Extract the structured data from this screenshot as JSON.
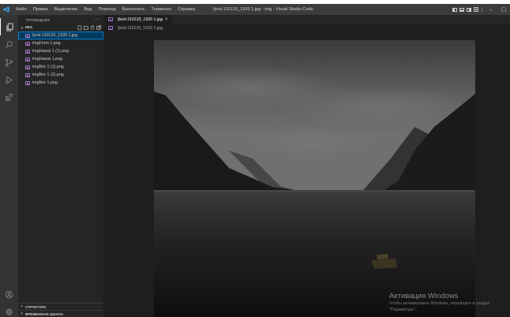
{
  "titlebar": {
    "menu": [
      "Файл",
      "Правка",
      "Выделение",
      "Вид",
      "Переход",
      "Выполнить",
      "Терминал",
      "Справка"
    ],
    "window_title": "fjord-110133_1920 1.jpg - img - Visual Studio Code",
    "minimize_glyph": "–",
    "maximize_glyph": "▢"
  },
  "activity_bar": {
    "items": [
      "explorer-icon",
      "search-icon",
      "source-control-icon",
      "run-debug-icon",
      "extensions-icon"
    ],
    "bottom": [
      "account-icon",
      "settings-gear-icon"
    ]
  },
  "sidebar": {
    "title": "ПРОВОДНИК",
    "more": "···",
    "folder": {
      "chevron": "∨",
      "name": "IMG"
    },
    "files": [
      "fjord-110133_1920 1.jpg",
      "imgForm 1.png",
      "imgHawai 1 (1).png",
      "imgHawai 1.png",
      "imgNor 1 (1).png",
      "imgNor 1 (2).png",
      "imgNor 1.png"
    ],
    "selected_index": 0,
    "sections": [
      {
        "chevron": ">",
        "label": "СТРУКТУРА"
      },
      {
        "chevron": ">",
        "label": "ВРЕМЕННАЯ ШКАЛА"
      }
    ]
  },
  "editor": {
    "tab": {
      "label": "fjord-110133_1920 1.jpg",
      "close": "×"
    },
    "breadcrumb": "fjord-110133_1920 1.jpg"
  },
  "watermark": {
    "title": "Активация Windows",
    "line1": "Чтобы активировать Windows, перейдите в раздел",
    "line2": "\"Параметры\"."
  },
  "colors": {
    "accent": "#007fd4",
    "selection": "#04395e",
    "image_icon": "#a074c4"
  }
}
